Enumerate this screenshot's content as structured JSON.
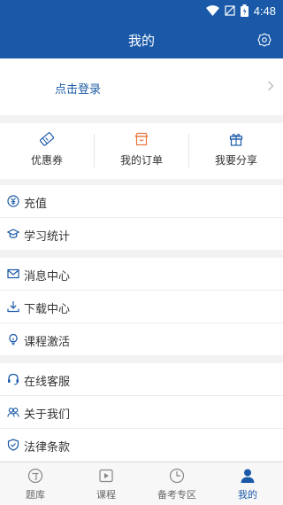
{
  "status_bar": {
    "time": "4:48"
  },
  "header": {
    "title": "我的"
  },
  "login": {
    "label": "点击登录"
  },
  "quick_actions": [
    {
      "label": "优惠券",
      "icon": "coupon-icon"
    },
    {
      "label": "我的订单",
      "icon": "order-icon"
    },
    {
      "label": "我要分享",
      "icon": "gift-icon"
    }
  ],
  "menu_groups": [
    [
      {
        "label": "充值",
        "icon": "recharge-icon"
      },
      {
        "label": "学习统计",
        "icon": "graduation-cap-icon"
      }
    ],
    [
      {
        "label": "消息中心",
        "icon": "mail-icon"
      },
      {
        "label": "下载中心",
        "icon": "download-icon"
      },
      {
        "label": "课程激活",
        "icon": "lightbulb-icon"
      }
    ],
    [
      {
        "label": "在线客服",
        "icon": "headset-icon"
      },
      {
        "label": "关于我们",
        "icon": "users-icon"
      },
      {
        "label": "法律条款",
        "icon": "shield-icon"
      }
    ]
  ],
  "tabs": [
    {
      "label": "题库",
      "icon": "question-bank-icon"
    },
    {
      "label": "课程",
      "icon": "play-icon"
    },
    {
      "label": "备考专区",
      "icon": "clock-icon"
    },
    {
      "label": "我的",
      "icon": "user-icon"
    }
  ],
  "colors": {
    "primary": "#1959a8",
    "accent": "#e8743b"
  }
}
